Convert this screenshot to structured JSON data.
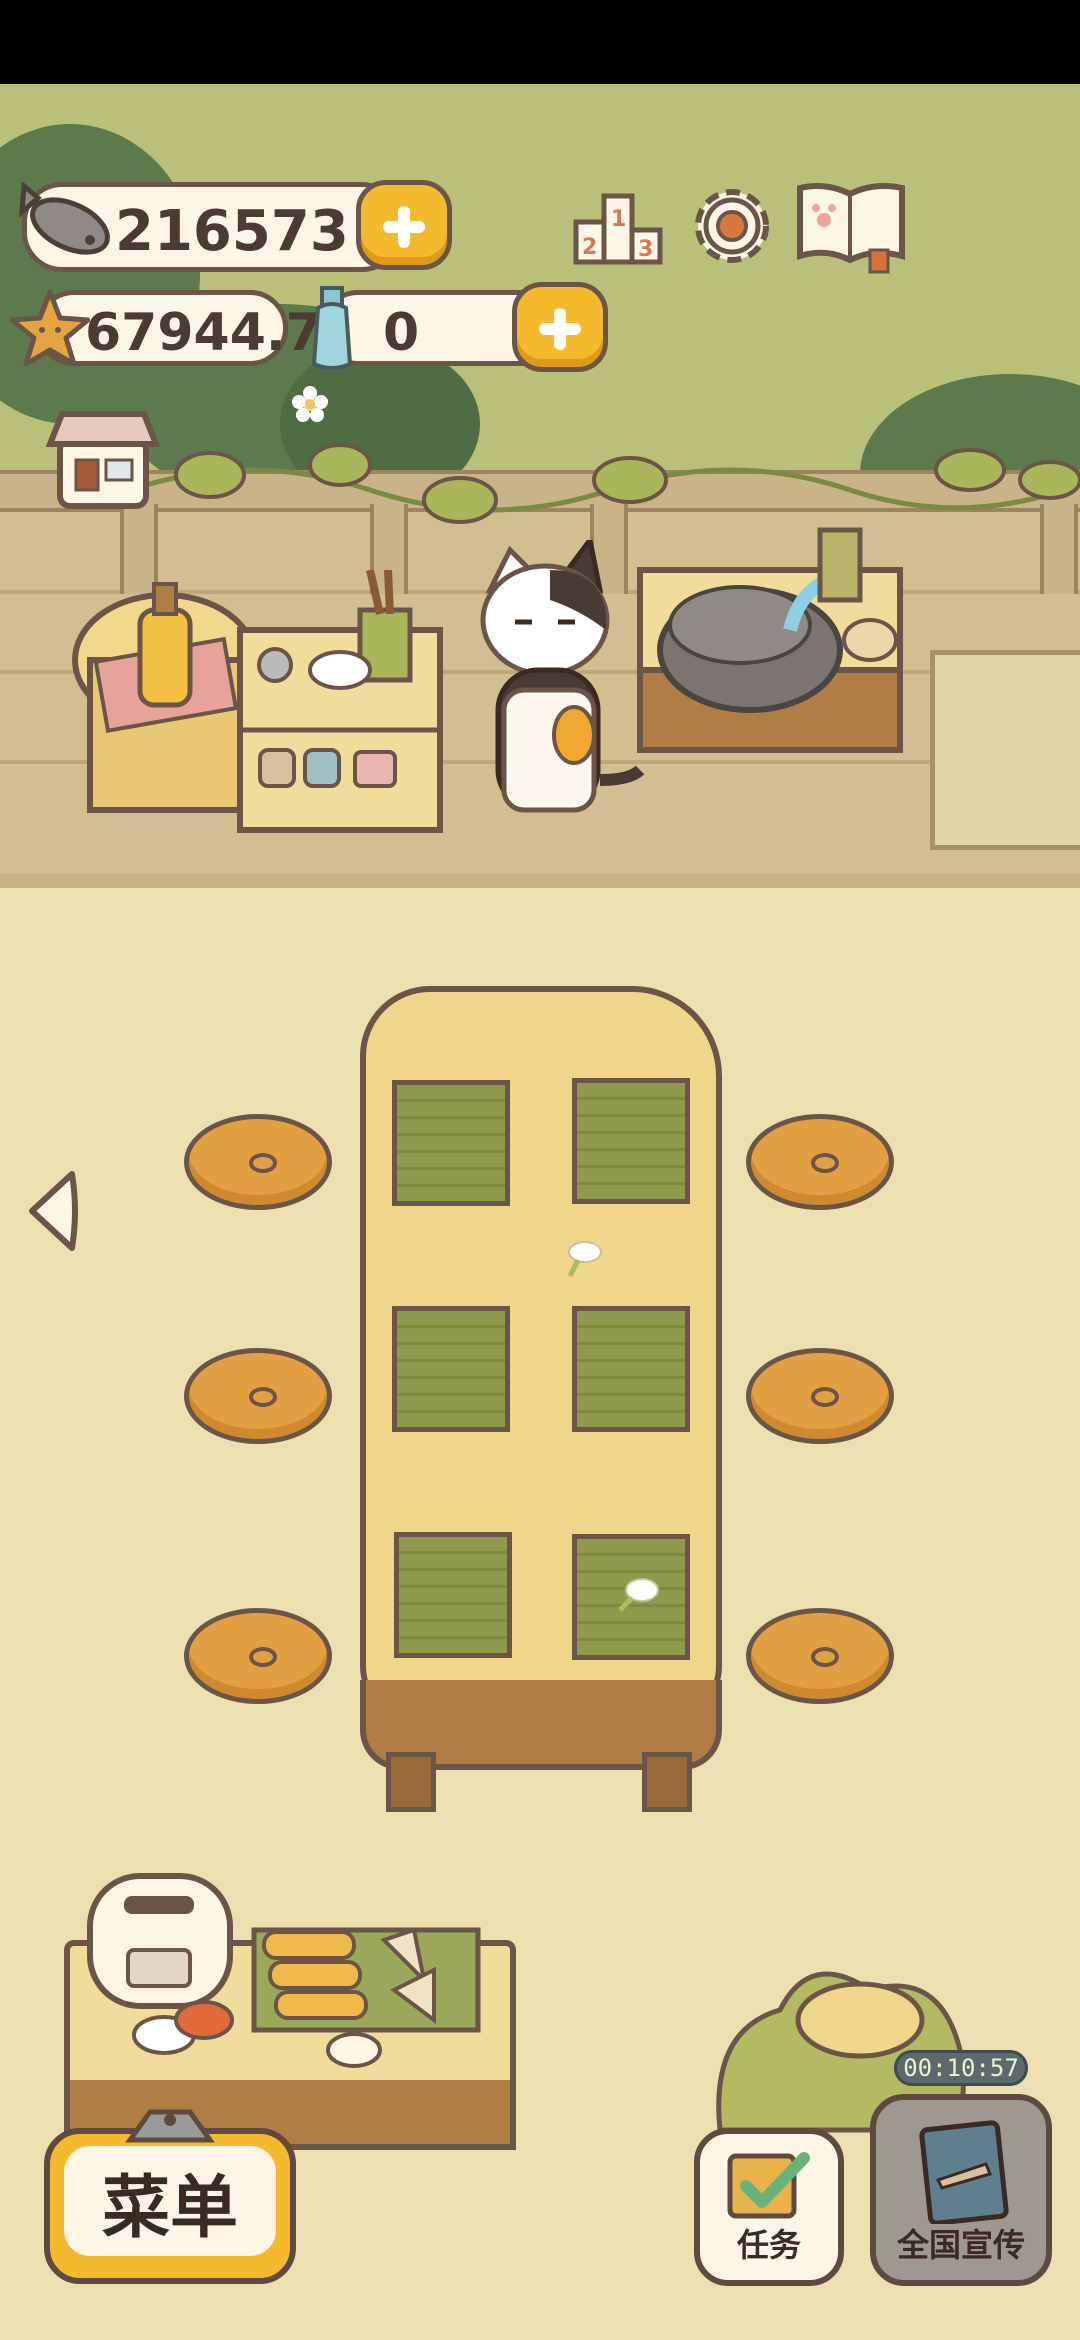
{
  "hud": {
    "fish_count": "216573",
    "star_count": "67944.7",
    "bottle_count": "0"
  },
  "menu_button": {
    "label": "菜单"
  },
  "task_button": {
    "label": "任务"
  },
  "promo_button": {
    "label": "全国宣传",
    "timer": "00:10:57"
  },
  "colors": {
    "accent_yellow": "#f5b92e",
    "outline_brown": "#6b5548",
    "floor": "#ece0b0",
    "garden": "#b8c07a"
  },
  "icons": [
    "fish-icon",
    "star-icon",
    "bottle-icon",
    "plus-icon",
    "ranking-podium-icon",
    "settings-gear-icon",
    "recipe-book-icon",
    "shop-icon",
    "left-arrow-icon",
    "clipboard-check-icon",
    "poster-icon"
  ]
}
